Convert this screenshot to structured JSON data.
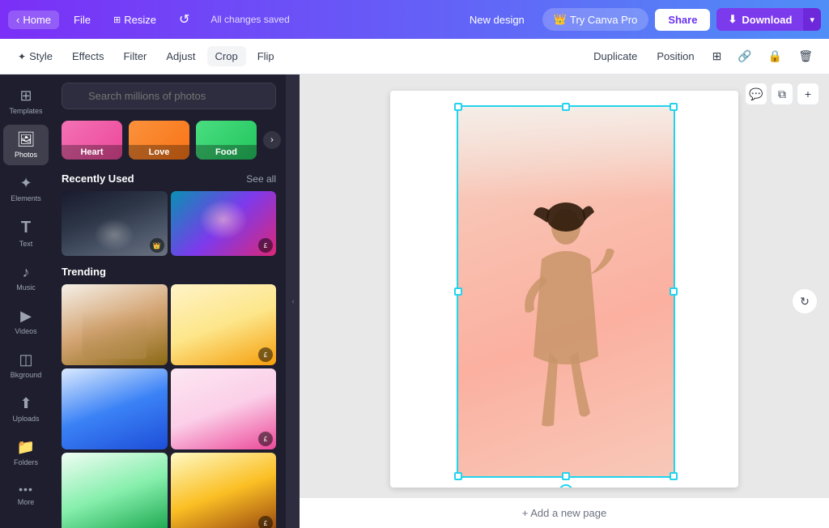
{
  "topnav": {
    "home_label": "Home",
    "file_label": "File",
    "resize_label": "Resize",
    "saved_label": "All changes saved",
    "new_design_label": "New design",
    "try_pro_label": "Try Canva Pro",
    "share_label": "Share",
    "download_label": "Download"
  },
  "toolbar": {
    "style_label": "Style",
    "effects_label": "Effects",
    "filter_label": "Filter",
    "adjust_label": "Adjust",
    "crop_label": "Crop",
    "flip_label": "Flip",
    "duplicate_label": "Duplicate",
    "position_label": "Position"
  },
  "sidebar": {
    "items": [
      {
        "id": "templates",
        "label": "Templates",
        "icon": "⊞"
      },
      {
        "id": "photos",
        "label": "Photos",
        "icon": "🖼"
      },
      {
        "id": "elements",
        "label": "Elements",
        "icon": "✦"
      },
      {
        "id": "text",
        "label": "Text",
        "icon": "T"
      },
      {
        "id": "music",
        "label": "Music",
        "icon": "♪"
      },
      {
        "id": "videos",
        "label": "Videos",
        "icon": "▶"
      },
      {
        "id": "background",
        "label": "Bkground",
        "icon": "◫"
      },
      {
        "id": "uploads",
        "label": "Uploads",
        "icon": "⬆"
      },
      {
        "id": "folders",
        "label": "Folders",
        "icon": "📁"
      },
      {
        "id": "more",
        "label": "More",
        "icon": "···"
      }
    ]
  },
  "panel": {
    "search_placeholder": "Search millions of photos",
    "categories": [
      {
        "label": "Heart"
      },
      {
        "label": "Love"
      },
      {
        "label": "Food"
      }
    ],
    "recently_used_title": "Recently Used",
    "see_all_label": "See all",
    "trending_title": "Trending"
  },
  "canvas": {
    "add_page_label": "+ Add a new page",
    "canvas_actions": [
      {
        "id": "comment",
        "icon": "💬"
      },
      {
        "id": "copy",
        "icon": "⧉"
      },
      {
        "id": "add",
        "icon": "+"
      }
    ]
  }
}
